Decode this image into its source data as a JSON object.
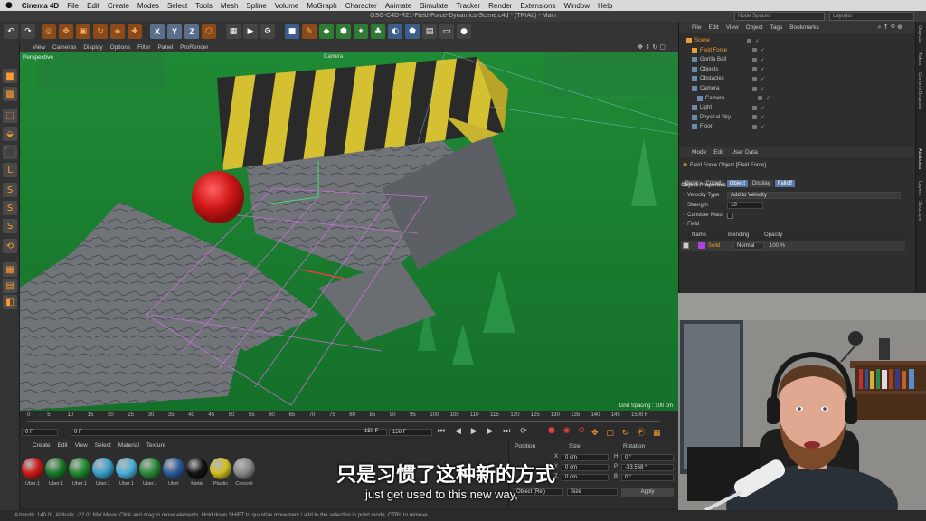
{
  "menubar": {
    "apple": "",
    "app": "Cinema 4D",
    "items": [
      "File",
      "Edit",
      "Create",
      "Modes",
      "Select",
      "Tools",
      "Mesh",
      "Spline",
      "Volume",
      "MoGraph",
      "Character",
      "Animate",
      "Simulate",
      "Tracker",
      "Render",
      "Extensions",
      "Window",
      "Help"
    ]
  },
  "window": {
    "title": "GSG-C4D-R21-Field-Force-Dynamics-Scene.c4d * (TRIAL) - Main",
    "node_spaces": "Node Spaces",
    "layouts": "Layouts"
  },
  "toolbar": {
    "x_label": "X",
    "y_label": "Y",
    "z_label": "Z"
  },
  "viewport": {
    "menu": [
      "View",
      "Cameras",
      "Display",
      "Options",
      "Filter",
      "Panel",
      "ProRender"
    ],
    "label": "Perspective",
    "camera_label": "Camera",
    "grid_spacing": "Grid Spacing : 100 cm"
  },
  "timeline": {
    "ticks": [
      "0",
      "5",
      "10",
      "15",
      "20",
      "25",
      "30",
      "35",
      "40",
      "45",
      "50",
      "55",
      "60",
      "65",
      "70",
      "75",
      "80",
      "85",
      "90",
      "95",
      "100",
      "105",
      "110",
      "115",
      "120",
      "125",
      "130",
      "135",
      "140",
      "145",
      "150"
    ],
    "current_frame": "0 F",
    "start_field": "0 F",
    "min_field": "0 F",
    "end_field": "150 F",
    "max_field": "150 F",
    "end_label": "0 F"
  },
  "materials": {
    "menu": [
      "Create",
      "Edit",
      "View",
      "Select",
      "Material",
      "Texture"
    ],
    "items": [
      {
        "name": "Uber.1",
        "color": "#d01818"
      },
      {
        "name": "Uber.1",
        "color": "#1a7a2a"
      },
      {
        "name": "Uber.1",
        "color": "#1f8a2f"
      },
      {
        "name": "Uber.1",
        "color": "#3aa0d0"
      },
      {
        "name": "Uber.1",
        "color": "#4ab0d8"
      },
      {
        "name": "Uber.1",
        "color": "#2a8a3a"
      },
      {
        "name": "Uber",
        "color": "#2a5a9a"
      },
      {
        "name": "Metal",
        "color": "#111111"
      },
      {
        "name": "Plastic",
        "color": "#d0c020"
      },
      {
        "name": "Concret",
        "color": "#888888"
      }
    ]
  },
  "coords": {
    "headers": [
      "Position",
      "Size",
      "Rotation"
    ],
    "rows": [
      {
        "axis": "X",
        "pos": "0 cm",
        "rot_axis": "H",
        "rot": "0 °"
      },
      {
        "axis": "Y",
        "pos": "0 cm",
        "rot_axis": "P",
        "rot": "-33.568 °"
      },
      {
        "axis": "Z",
        "pos": "0 cm",
        "rot_axis": "B",
        "rot": "0 °"
      }
    ],
    "mode_select": "Object (Rel)",
    "size_select": "Size",
    "apply": "Apply"
  },
  "object_manager": {
    "menu": [
      "File",
      "Edit",
      "View",
      "Object",
      "Tags",
      "Bookmarks"
    ],
    "objects": [
      {
        "name": "Scene",
        "color": "#e89a30",
        "indent": 0
      },
      {
        "name": "Field Force",
        "color": "#e8a030",
        "indent": 1
      },
      {
        "name": "Gorilla Ball",
        "color": "#c8c8c8",
        "indent": 1
      },
      {
        "name": "Objects",
        "color": "#c8c8c8",
        "indent": 1
      },
      {
        "name": "Obstacles",
        "color": "#c8c8c8",
        "indent": 1
      },
      {
        "name": "Camera",
        "color": "#c8c8c8",
        "indent": 1
      },
      {
        "name": "Camera",
        "color": "#c8c8c8",
        "indent": 2
      },
      {
        "name": "Light",
        "color": "#c8c8c8",
        "indent": 1
      },
      {
        "name": "Physical Sky",
        "color": "#c8c8c8",
        "indent": 1
      },
      {
        "name": "Floor",
        "color": "#c8c8c8",
        "indent": 1
      }
    ]
  },
  "attributes": {
    "menu": [
      "Mode",
      "Edit",
      "User Data"
    ],
    "object_title": "Field Force Object [Field Force]",
    "tabs": [
      {
        "label": "Basic",
        "active": false
      },
      {
        "label": "Coord.",
        "active": false
      },
      {
        "label": "Object",
        "active": true
      },
      {
        "label": "Display",
        "active": false
      },
      {
        "label": "Falloff",
        "active": true
      }
    ],
    "section": "Object Properties",
    "velocity_type_label": "Velocity Type",
    "velocity_type_value": "Add to Velocity",
    "strength_label": "Strength",
    "strength_value": "10",
    "consider_mass_label": "Consider Mass",
    "field_label": "Field",
    "field_headers": [
      "Name",
      "Blending",
      "Opacity"
    ],
    "field_row": {
      "name": "Solid",
      "blending": "Normal",
      "opacity": "100 %"
    }
  },
  "right_strip": [
    "Objects",
    "Takes",
    "Content Browser",
    "Attributes",
    "Layers",
    "Structure"
  ],
  "status": {
    "text": "Azimuth: 140.0°, Altitude: -22.0°  NW     Move: Click and drag to move elements. Hold down SHIFT to quantize movement / add to the selection in point mode, CTRL to remove."
  },
  "subtitles": {
    "zh": "只是习惯了这种新的方式",
    "en": "just get used to this new way,"
  }
}
